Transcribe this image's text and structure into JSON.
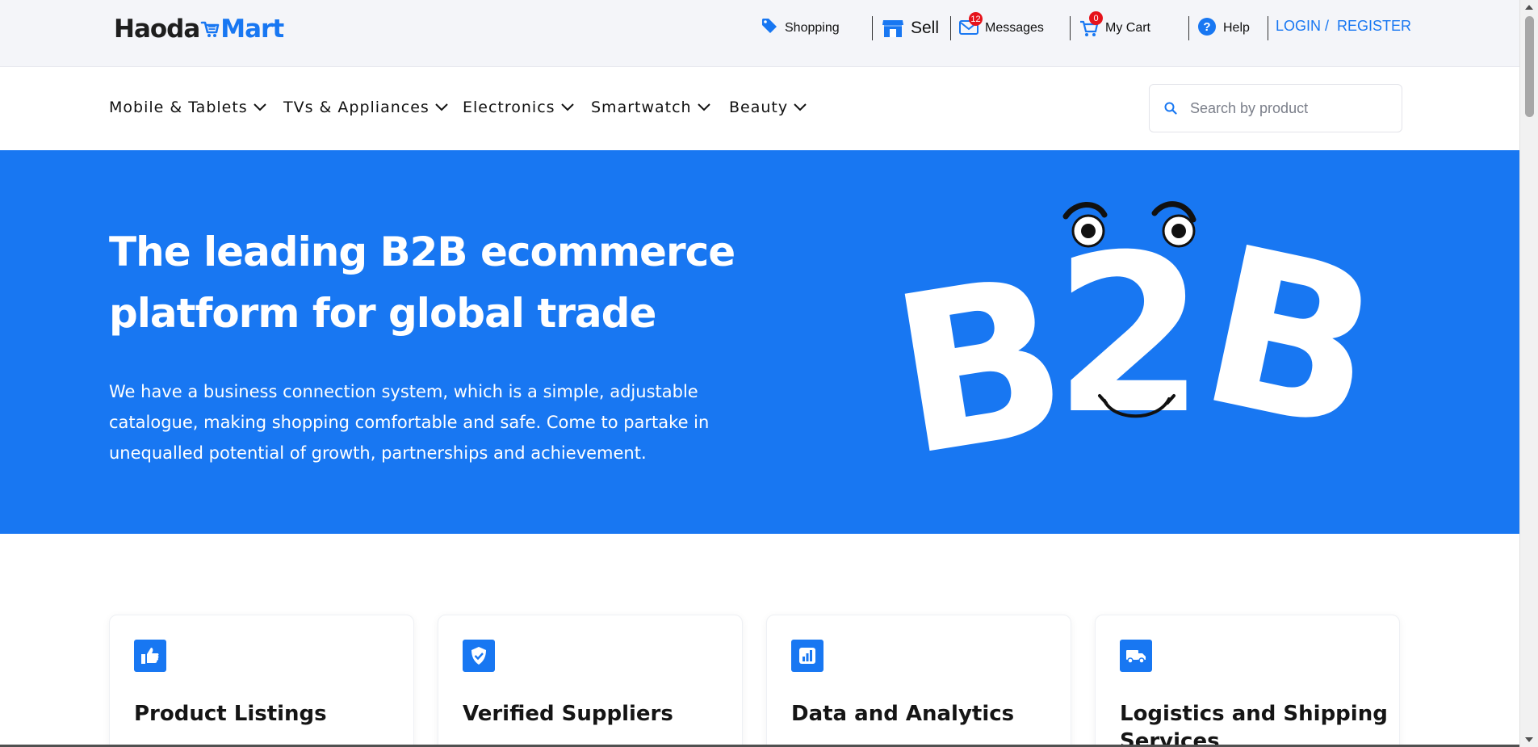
{
  "brand": {
    "part1": "Haoda",
    "part2": "Mart"
  },
  "topnav": {
    "shopping": "Shopping",
    "sell": "Sell",
    "messages": "Messages",
    "messages_count": "12",
    "cart": "My Cart",
    "cart_count": "0",
    "help": "Help",
    "login": "LOGIN /",
    "register": "REGISTER"
  },
  "categories": [
    {
      "label": "Mobile & Tablets"
    },
    {
      "label": "TVs & Appliances"
    },
    {
      "label": "Electronics"
    },
    {
      "label": "Smartwatch"
    },
    {
      "label": "Beauty"
    }
  ],
  "search": {
    "placeholder": "Search by product"
  },
  "hero": {
    "title": "The leading B2B ecommerce platform for global trade",
    "text": "We have a business connection system, which is a simple, adjustable catalogue, making shopping comfortable and safe. Come to partake in unequalled potential of growth, partnerships and achievement.",
    "graphic_text": "B2B"
  },
  "features": [
    {
      "title": "Product Listings",
      "icon": "thumbs-up-icon"
    },
    {
      "title": "Verified Suppliers",
      "icon": "shield-check-icon"
    },
    {
      "title": "Data and Analytics",
      "icon": "bar-chart-icon"
    },
    {
      "title": "Logistics and Shipping Services",
      "icon": "truck-icon"
    }
  ],
  "colors": {
    "primary": "#1877f2",
    "badge": "#e6131b",
    "topbar": "#f4f5f9"
  }
}
